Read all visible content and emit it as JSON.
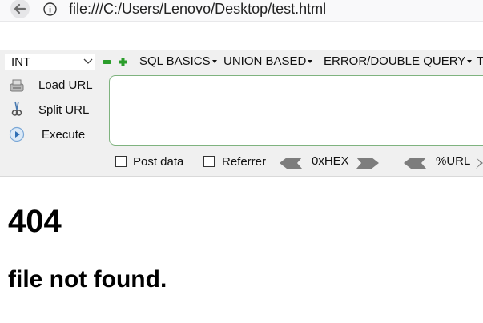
{
  "browser": {
    "url": "file:///C:/Users/Lenovo/Desktop/test.html",
    "icons": {
      "back": "back-arrow-icon",
      "info": "info-circle-icon"
    }
  },
  "hackbar": {
    "type_select": "INT",
    "menu": [
      "SQL BASICS",
      "UNION BASED",
      "ERROR/DOUBLE QUERY",
      "T"
    ],
    "actions": {
      "load_url": "Load URL",
      "split_url": "Split URL",
      "execute": "Execute"
    },
    "options": {
      "post_data": "Post data",
      "referrer": "Referrer",
      "hex": "0xHEX",
      "url_enc": "%URL"
    },
    "colors": {
      "accent_green": "#2a9d2a",
      "border_green": "#7fb37f"
    }
  },
  "page": {
    "heading": "404",
    "message": "file not found."
  }
}
